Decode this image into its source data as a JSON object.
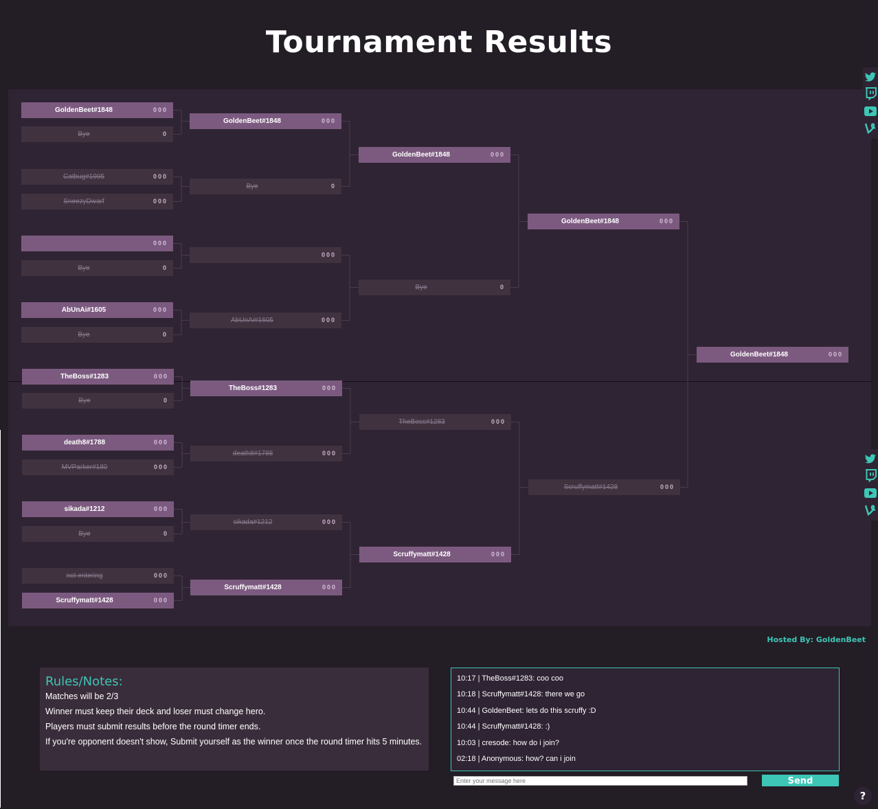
{
  "page": {
    "title": "Tournament Results",
    "hosted_by": "Hosted By: GoldenBeet",
    "accent_color": "#3dc6b6",
    "win_color": "#7c5a80"
  },
  "bracket": {
    "round1": [
      {
        "name": "GoldenBeet#1848",
        "score": "000",
        "result": "win"
      },
      {
        "name": "Bye",
        "score": "0",
        "result": "lose"
      },
      {
        "name": "Catbug#1995",
        "score": "000",
        "result": "lose"
      },
      {
        "name": "SneezyDwarf",
        "score": "000",
        "result": "lose"
      },
      {
        "name": "",
        "score": "000",
        "result": "win"
      },
      {
        "name": "Bye",
        "score": "0",
        "result": "lose"
      },
      {
        "name": "AbUnAi#1605",
        "score": "000",
        "result": "win"
      },
      {
        "name": "Bye",
        "score": "0",
        "result": "lose"
      },
      {
        "name": "TheBoss#1283",
        "score": "000",
        "result": "win"
      },
      {
        "name": "Bye",
        "score": "0",
        "result": "lose"
      },
      {
        "name": "death8#1788",
        "score": "000",
        "result": "win"
      },
      {
        "name": "MVParker#180",
        "score": "000",
        "result": "lose"
      },
      {
        "name": "sikada#1212",
        "score": "000",
        "result": "win"
      },
      {
        "name": "Bye",
        "score": "0",
        "result": "lose"
      },
      {
        "name": "not entering",
        "score": "000",
        "result": "lose"
      },
      {
        "name": "Scruffymatt#1428",
        "score": "000",
        "result": "win"
      }
    ],
    "round2": [
      {
        "name": "GoldenBeet#1848",
        "score": "000",
        "result": "win"
      },
      {
        "name": "Bye",
        "score": "0",
        "result": "lose"
      },
      {
        "name": "",
        "score": "000",
        "result": "none"
      },
      {
        "name": "AbUnAi#1605",
        "score": "000",
        "result": "lose"
      },
      {
        "name": "TheBoss#1283",
        "score": "000",
        "result": "win"
      },
      {
        "name": "death8#1788",
        "score": "000",
        "result": "lose"
      },
      {
        "name": "sikada#1212",
        "score": "000",
        "result": "lose"
      },
      {
        "name": "Scruffymatt#1428",
        "score": "000",
        "result": "win"
      }
    ],
    "round3": [
      {
        "name": "GoldenBeet#1848",
        "score": "000",
        "result": "win"
      },
      {
        "name": "Bye",
        "score": "0",
        "result": "lose"
      },
      {
        "name": "TheBoss#1283",
        "score": "000",
        "result": "lose"
      },
      {
        "name": "Scruffymatt#1428",
        "score": "000",
        "result": "win"
      }
    ],
    "round4": [
      {
        "name": "GoldenBeet#1848",
        "score": "000",
        "result": "win"
      },
      {
        "name": "Scruffymatt#1428",
        "score": "000",
        "result": "lose"
      }
    ],
    "final": [
      {
        "name": "GoldenBeet#1848",
        "score": "000",
        "result": "win"
      }
    ]
  },
  "social_icons": [
    "twitter-icon",
    "twitch-icon",
    "youtube-icon",
    "vine-icon"
  ],
  "rules": {
    "heading": "Rules/Notes:",
    "lines": [
      "Matches will be 2/3",
      "Winner must keep their deck and loser must change hero.",
      "Players must submit results before the round timer ends.",
      "If you're opponent doesn't show, Submit yourself as the winner once the round timer hits 5 minutes."
    ]
  },
  "chat": {
    "messages": [
      "10:17 | TheBoss#1283: coo coo",
      "10:18 | Scruffymatt#1428: there we go",
      "10:44 | GoldenBeet: lets do this scruffy :D",
      "10:44 | Scruffymatt#1428: :)",
      "10:03 | cresode: how do i join?",
      "02:18 | Anonymous: how? can i join"
    ],
    "input_placeholder": "Enter your message here",
    "send_label": "Send"
  },
  "help_label": "?"
}
